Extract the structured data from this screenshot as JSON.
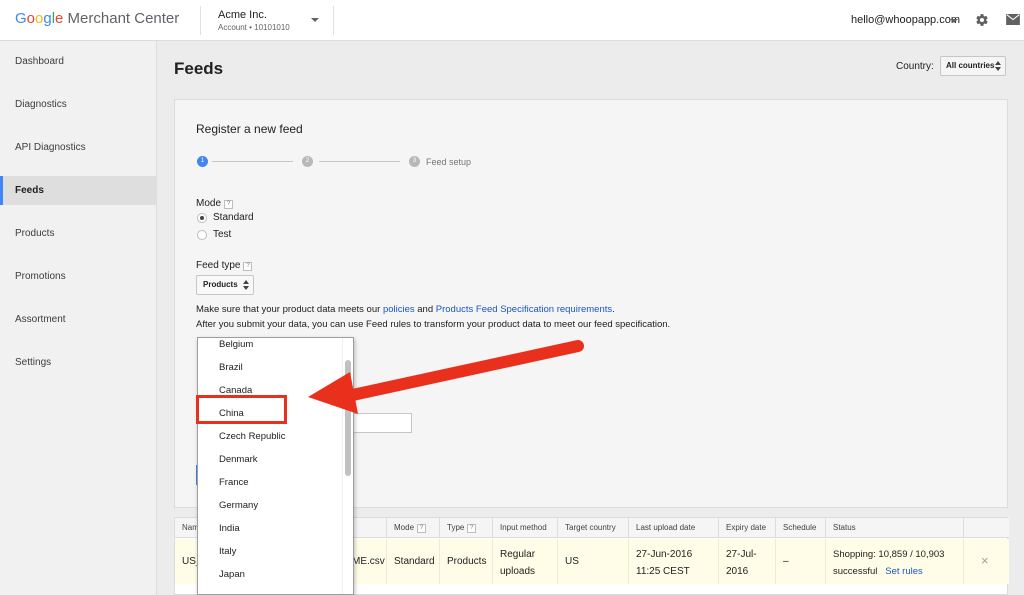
{
  "header": {
    "logo_parts": [
      "G",
      "o",
      "o",
      "g",
      "l",
      "e"
    ],
    "logo_rest": " Merchant Center",
    "account_name": "Acme Inc.",
    "account_sub": "Account  •  10101010",
    "user_email": "hello@whoopapp.com"
  },
  "sidebar": {
    "items": [
      {
        "label": "Dashboard"
      },
      {
        "label": "Diagnostics"
      },
      {
        "label": "API Diagnostics"
      },
      {
        "label": "Feeds"
      },
      {
        "label": "Products"
      },
      {
        "label": "Promotions"
      },
      {
        "label": "Assortment"
      },
      {
        "label": "Settings"
      }
    ],
    "active": "Feeds"
  },
  "page": {
    "title": "Feeds",
    "country_label": "Country:",
    "country_value": "All countries"
  },
  "register": {
    "title": "Register a new feed",
    "steps": [
      "1",
      "2",
      "3"
    ],
    "step3_label": "Feed setup",
    "mode_label": "Mode",
    "help": "?",
    "mode_options": [
      "Standard",
      "Test"
    ],
    "mode_selected": "Standard",
    "feed_type_label": "Feed type",
    "feed_type_value": "Products",
    "info1_before": "Make sure that your product data meets our ",
    "info1_link1": "policies",
    "info1_mid": " and ",
    "info1_link2": "Products Feed Specification requirements",
    "info1_after": ".",
    "info2": "After you submit your data, you can use Feed rules to transform your product data to meet our feed specification."
  },
  "country_dropdown": {
    "items": [
      "Belgium",
      "Brazil",
      "Canada",
      "China",
      "Czech Republic",
      "Denmark",
      "France",
      "Germany",
      "India",
      "Italy",
      "Japan"
    ],
    "highlighted": "China"
  },
  "table": {
    "headers": [
      "Nam",
      "",
      "Mode",
      "Type",
      "Input method",
      "Target country",
      "Last upload date",
      "Expiry date",
      "Schedule",
      "Status",
      ""
    ],
    "row": {
      "name": "US_",
      "file": "ME.csv",
      "mode": "Standard",
      "type": "Products",
      "input_method_1": "Regular",
      "input_method_2": "uploads",
      "target_country": "US",
      "last_upload_1": "27-Jun-2016",
      "last_upload_2": "11:25 CEST",
      "expiry_1": "27-Jul-",
      "expiry_2": "2016",
      "schedule": "–",
      "status_1": "Shopping: 10,859 / 10,903",
      "status_2": "successful",
      "status_link": "Set rules",
      "close": "×"
    }
  },
  "colors": {
    "accent": "#4285f4",
    "link": "#1a55c4",
    "annotation_red": "#e8301c",
    "row_highlight": "#fffde7"
  }
}
